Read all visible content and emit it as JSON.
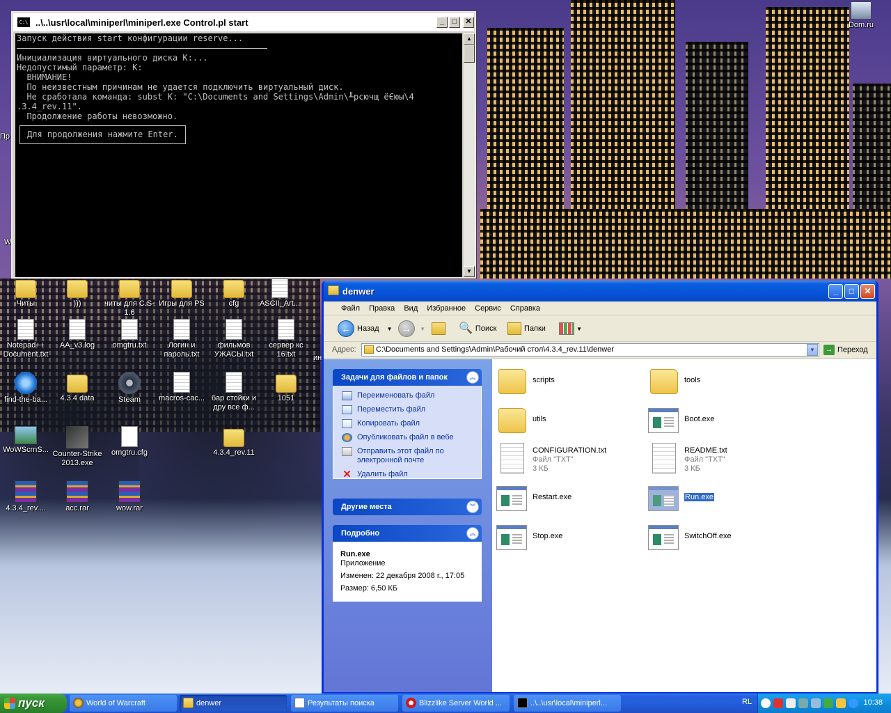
{
  "desktop": {
    "icons": [
      {
        "label": "Читы",
        "type": "folder"
      },
      {
        "label": ")))",
        "type": "folder"
      },
      {
        "label": "читы для C.S-1.6",
        "type": "folder"
      },
      {
        "label": "Игры для PS",
        "type": "folder"
      },
      {
        "label": "cfg",
        "type": "folder"
      },
      {
        "label": "ASCII_Art...",
        "type": "doc"
      },
      {
        "label": "Notepad++ Document.txt",
        "type": "doc"
      },
      {
        "label": "AA_v3.log",
        "type": "doc"
      },
      {
        "label": "omgtru.txt",
        "type": "doc"
      },
      {
        "label": "Логин и пароль.txt",
        "type": "doc"
      },
      {
        "label": "фильмов УЖАСЫ.txt",
        "type": "doc"
      },
      {
        "label": "сервер кс 16.txt",
        "type": "doc"
      },
      {
        "label": "find-the-ba...",
        "type": "ie"
      },
      {
        "label": "4.3.4 data",
        "type": "folder"
      },
      {
        "label": "Steam",
        "type": "steam"
      },
      {
        "label": "macros-cac...",
        "type": "doc"
      },
      {
        "label": "бар стойки и дру все ф...",
        "type": "doc"
      },
      {
        "label": "1051",
        "type": "folder"
      },
      {
        "label": "WoWScrnS...",
        "type": "img"
      },
      {
        "label": "Counter-Strike 2013.exe",
        "type": "cs"
      },
      {
        "label": "omgtru.cfg",
        "type": "cfg"
      },
      {
        "label": "4.3.4_rev.11",
        "type": "folder"
      },
      {
        "label": "4.3.4_rev....",
        "type": "rar"
      },
      {
        "label": "acc.rar",
        "type": "rar"
      },
      {
        "label": "wow.rar",
        "type": "rar"
      },
      {
        "label": "Dom.ru",
        "type": "net"
      }
    ],
    "edge_fragments": [
      "Пр",
      "W",
      "ин"
    ]
  },
  "console": {
    "title": "..\\..\\usr\\local\\miniperl\\miniperl.exe Control.pl start",
    "lines": [
      "Запуск действия start конфигурации reserve...",
      "",
      "Инициализация виртуального диска K:...",
      "Недопустимый параметр: K:",
      "  ВНИМАНИЕ!",
      "  По неизвестным причинам не удается подключить виртуальный диск.",
      "  Не сработала команда: subst K: \"C:\\Documents and Settings\\Admin\\╨рсючщ ёЄюы\\4",
      ".3.4_rev.11\".",
      "  Продолжение работы невозможно."
    ],
    "prompt": "Для продолжения нажмите Enter."
  },
  "explorer": {
    "title": "denwer",
    "menu": [
      "Файл",
      "Правка",
      "Вид",
      "Избранное",
      "Сервис",
      "Справка"
    ],
    "toolbar": {
      "back": "Назад",
      "search": "Поиск",
      "folders": "Папки"
    },
    "address": {
      "label": "Адрес:",
      "value": "C:\\Documents and Settings\\Admin\\Рабочий стол\\4.3.4_rev.11\\denwer",
      "go": "Переход"
    },
    "tasks": {
      "header": "Задачи для файлов и папок",
      "items": [
        "Переименовать файл",
        "Переместить файл",
        "Копировать файл",
        "Опубликовать файл в вебе",
        "Отправить этот файл по электронной почте",
        "Удалить файл"
      ]
    },
    "other_places": {
      "header": "Другие места"
    },
    "details": {
      "header": "Подробно",
      "name": "Run.exe",
      "type": "Приложение",
      "modified": "Изменен: 22 декабря 2008 г., 17:05",
      "size": "Размер: 6,50 КБ"
    },
    "files": [
      {
        "name": "scripts",
        "kind": "folder"
      },
      {
        "name": "tools",
        "kind": "folder"
      },
      {
        "name": "utils",
        "kind": "folder"
      },
      {
        "name": "Boot.exe",
        "kind": "exe"
      },
      {
        "name": "CONFIGURATION.txt",
        "kind": "txt",
        "type": "Файл \"TXT\"",
        "size": "3 КБ"
      },
      {
        "name": "README.txt",
        "kind": "txt",
        "type": "Файл \"TXT\"",
        "size": "3 КБ"
      },
      {
        "name": "Restart.exe",
        "kind": "exe"
      },
      {
        "name": "Run.exe",
        "kind": "exe",
        "selected": true
      },
      {
        "name": "Stop.exe",
        "kind": "exe"
      },
      {
        "name": "SwitchOff.exe",
        "kind": "exe"
      }
    ]
  },
  "taskbar": {
    "start": "пуск",
    "buttons": [
      {
        "label": "World of Warcraft",
        "icon": "wow"
      },
      {
        "label": "denwer",
        "icon": "folder",
        "active": true
      },
      {
        "label": "Результаты поиска",
        "icon": "search"
      },
      {
        "label": "Blizzlike Server World ...",
        "icon": "opera"
      },
      {
        "label": "..\\..\\usr\\local\\miniperl...",
        "icon": "cmd"
      }
    ],
    "lang": "RL",
    "clock": "10:38"
  }
}
